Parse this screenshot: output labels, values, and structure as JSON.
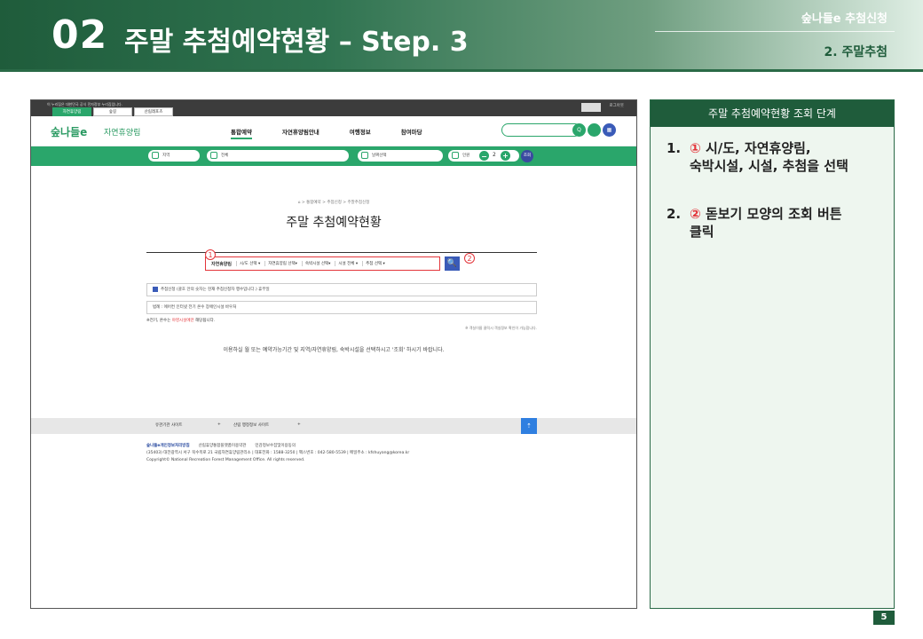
{
  "header": {
    "number": "02",
    "title": "주말 추첨예약현황 – Step. 3",
    "top_right_1": "숲나들e 추첨신청",
    "top_right_2": "2. 주말추첨"
  },
  "screenshot": {
    "notice": "이 누리집은 대한민국 공식 전자정부 누리집입니다.",
    "tabs": [
      "자연휴양림",
      "숲길",
      "산림레포츠"
    ],
    "login": "로그아웃",
    "logo": "숲나들e",
    "logo_sub": "자연휴양림",
    "menu": [
      "통합예약",
      "자연휴양림안내",
      "여행정보",
      "참여마당"
    ],
    "quick_icons": [
      "검색",
      "추천휴양림",
      "메뉴"
    ],
    "pills": [
      "지역",
      "전체",
      "날짜선택",
      "인원"
    ],
    "guest_count": "2",
    "go": "조회",
    "breadcrumb": "⌂ > 통합예약 > 추첨신청 > 주말추첨신청",
    "page_title": "주말 추첨예약현황",
    "filter": {
      "label": "자연휴양림",
      "selects": [
        "시/도 선택 ▾",
        "자연휴양림 선택▾",
        "숙박시설 선택▾",
        "시설 전체 ▾",
        "추첨 선택 ▾"
      ]
    },
    "search_button": "🔍",
    "badge1": "1",
    "badge2": "2",
    "box1": "추첨신청 (괄호 안의 숫자는 현재 추첨신청자 행수입니다.)     휴무일",
    "box2": "범례 :  에어컨   인터넷   전기   온수   장애인시설   바우처",
    "note1_prefix": "※전기, 온수는 ",
    "note1_red": "야영시설에만",
    "note1_suffix": " 해당됩니다.",
    "note2": "※ 객실이름 클릭시 객실정보 확인이 가능합니다.",
    "message": "이용하실 월 또는 예약가능기간 및 지역/자연휴양림, 숙박시설을 선택하시고 '조회' 하시기 바랍니다.",
    "footer_links": [
      "유관기관 사이트",
      "+",
      "산림 행정정보 사이트",
      "+"
    ],
    "top_button": "TOP",
    "info": {
      "privacy": "숲나들e개인정보처리방침",
      "links": [
        "산림휴양통합플랫폼이용약관",
        "민감정보수집및이용동의"
      ],
      "address": "(35403) 대전광역시 서구 북수목로 21 국립자연휴양림관리소 | 대표전화 : 1588-3250 | 팩스번호 : 042-580-5539 | 메일주소 : kfshuyang@korea.kr",
      "copyright": "Copyright© National Recreation Forest Management Office. All rights reserved."
    }
  },
  "panel": {
    "title": "주말 추첨예약현황 조회 단계",
    "steps": [
      {
        "n": "1.",
        "mark": "①",
        "text1": "시/도, 자연휴양림,",
        "text2": "숙박시설, 시설, 추첨을 선택"
      },
      {
        "n": "2.",
        "mark": "②",
        "text1": "돋보기 모양의 조회 버튼",
        "text2": "클릭"
      }
    ]
  },
  "page_number": "5"
}
